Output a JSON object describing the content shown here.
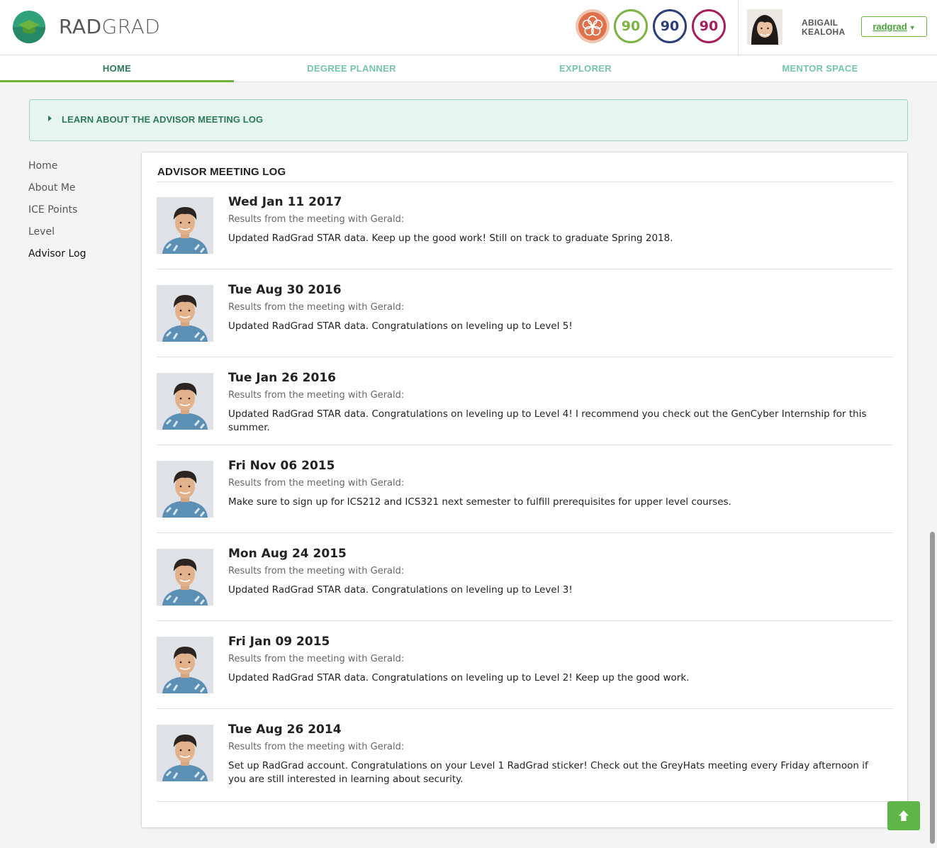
{
  "brand": {
    "part1": "RAD",
    "part2": "GRAD"
  },
  "ice": {
    "innovation": "90",
    "competency": "90",
    "experience": "90"
  },
  "colors": {
    "innovation": "#7cb342",
    "competency": "#2c3e7a",
    "experience": "#a51f5c",
    "accent": "#6cb33f"
  },
  "user": {
    "first_name": "ABIGAIL",
    "last_name": "KEALOHA",
    "account_label": "radgrad"
  },
  "nav": {
    "home": "HOME",
    "planner": "DEGREE PLANNER",
    "explorer": "EXPLORER",
    "mentor": "MENTOR SPACE"
  },
  "help": {
    "label": "LEARN ABOUT THE ADVISOR MEETING LOG"
  },
  "sidemenu": [
    "Home",
    "About Me",
    "ICE Points",
    "Level",
    "Advisor Log"
  ],
  "log": {
    "title": "ADVISOR MEETING LOG",
    "entries": [
      {
        "date": "Wed Jan 11 2017",
        "meta": "Results from the meeting with Gerald:",
        "text": "Updated RadGrad STAR data. Keep up the good work! Still on track to graduate Spring 2018."
      },
      {
        "date": "Tue Aug 30 2016",
        "meta": "Results from the meeting with Gerald:",
        "text": "Updated RadGrad STAR data. Congratulations on leveling up to Level 5!"
      },
      {
        "date": "Tue Jan 26 2016",
        "meta": "Results from the meeting with Gerald:",
        "text": "Updated RadGrad STAR data. Congratulations on leveling up to Level 4! I recommend you check out the GenCyber Internship for this summer."
      },
      {
        "date": "Fri Nov 06 2015",
        "meta": "Results from the meeting with Gerald:",
        "text": "Make sure to sign up for ICS212 and ICS321 next semester to fulfill prerequisites for upper level courses."
      },
      {
        "date": "Mon Aug 24 2015",
        "meta": "Results from the meeting with Gerald:",
        "text": "Updated RadGrad STAR data. Congratulations on leveling up to Level 3!"
      },
      {
        "date": "Fri Jan 09 2015",
        "meta": "Results from the meeting with Gerald:",
        "text": "Updated RadGrad STAR data. Congratulations on leveling up to Level 2! Keep up the good work."
      },
      {
        "date": "Tue Aug 26 2014",
        "meta": "Results from the meeting with Gerald:",
        "text": "Set up RadGrad account. Congratulations on your Level 1 RadGrad sticker! Check out the GreyHats meeting every Friday afternoon if you are still interested in learning about security."
      }
    ]
  }
}
